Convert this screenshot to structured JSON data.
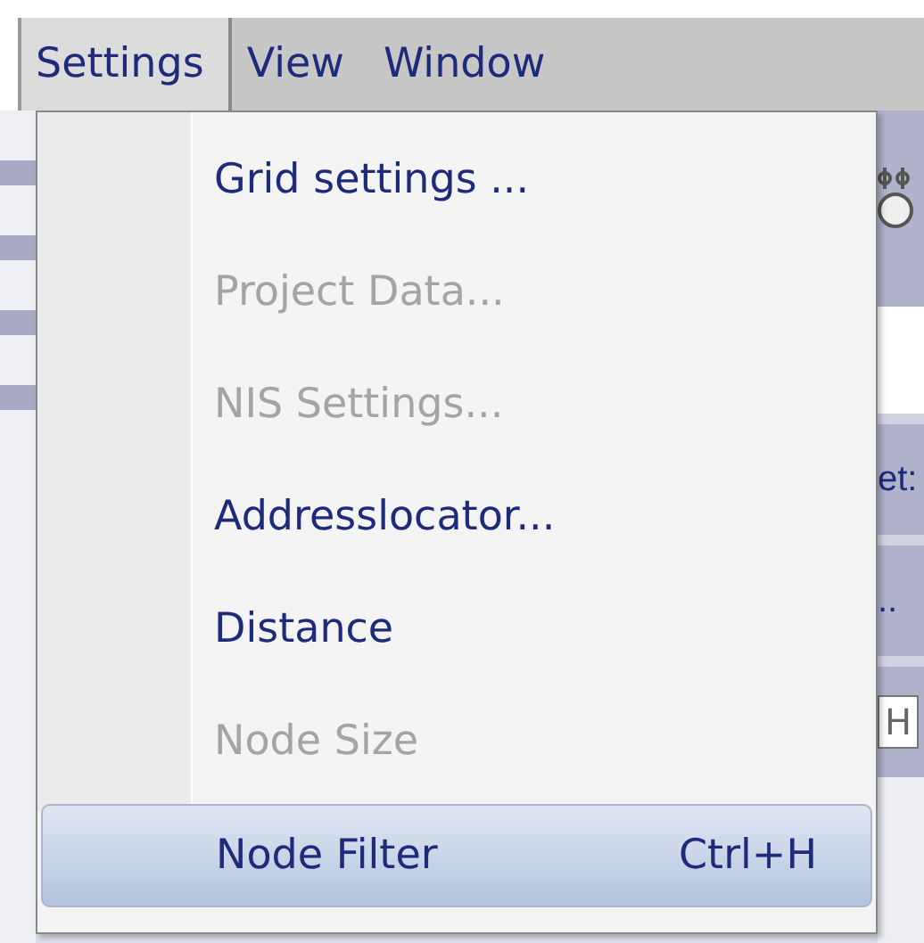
{
  "menubar": [
    {
      "label": "Settings",
      "selected": true
    },
    {
      "label": "View",
      "selected": false
    },
    {
      "label": "Window",
      "selected": false
    }
  ],
  "menu": [
    {
      "label": "Grid settings ...",
      "disabled": false,
      "selected": false
    },
    {
      "label": "Project Data...",
      "disabled": true,
      "selected": false
    },
    {
      "label": "NIS Settings...",
      "disabled": true,
      "selected": false
    },
    {
      "label": "Addresslocator...",
      "disabled": false,
      "selected": false
    },
    {
      "label": "Distance",
      "disabled": false,
      "selected": false
    },
    {
      "label": "Node Size",
      "disabled": true,
      "selected": false
    },
    {
      "label": "Node Filter",
      "shortcut": "Ctrl+H",
      "disabled": false,
      "selected": true
    }
  ],
  "background": {
    "label_fragment": "et:",
    "ellipsis": "..",
    "field_value": "H"
  }
}
